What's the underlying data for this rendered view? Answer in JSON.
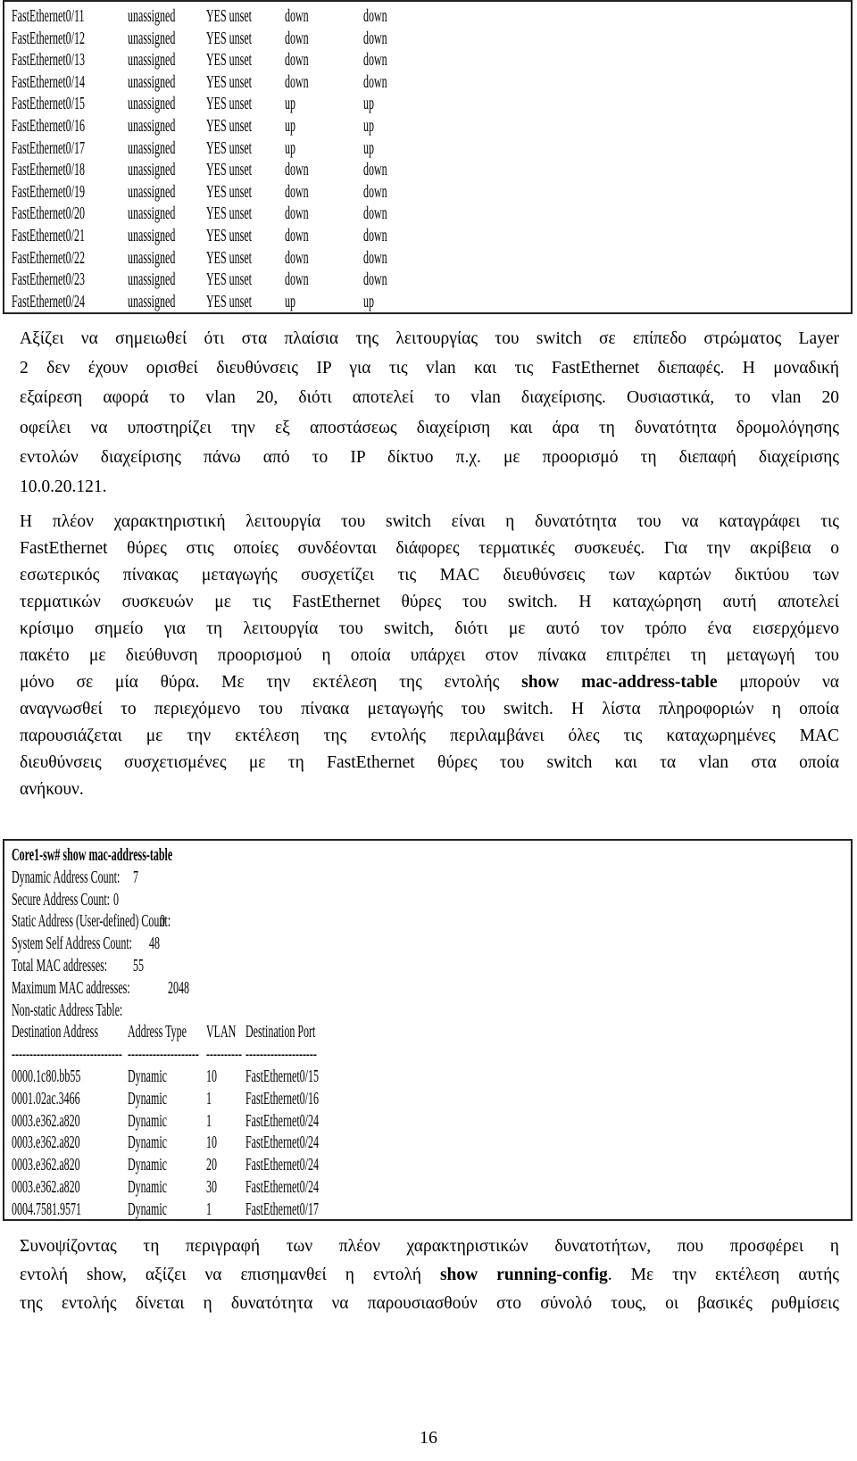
{
  "interface_table": [
    [
      "FastEthernet0/11",
      "unassigned",
      "YES unset",
      "down",
      "down"
    ],
    [
      "FastEthernet0/12",
      "unassigned",
      "YES unset",
      "down",
      "down"
    ],
    [
      "FastEthernet0/13",
      "unassigned",
      "YES unset",
      "down",
      "down"
    ],
    [
      "FastEthernet0/14",
      "unassigned",
      "YES unset",
      "down",
      "down"
    ],
    [
      "FastEthernet0/15",
      "unassigned",
      "YES unset",
      "up",
      "up"
    ],
    [
      "FastEthernet0/16",
      "unassigned",
      "YES unset",
      "up",
      "up"
    ],
    [
      "FastEthernet0/17",
      "unassigned",
      "YES unset",
      "up",
      "up"
    ],
    [
      "FastEthernet0/18",
      "unassigned",
      "YES unset",
      "down",
      "down"
    ],
    [
      "FastEthernet0/19",
      "unassigned",
      "YES unset",
      "down",
      "down"
    ],
    [
      "FastEthernet0/20",
      "unassigned",
      "YES unset",
      "down",
      "down"
    ],
    [
      "FastEthernet0/21",
      "unassigned",
      "YES unset",
      "down",
      "down"
    ],
    [
      "FastEthernet0/22",
      "unassigned",
      "YES unset",
      "down",
      "down"
    ],
    [
      "FastEthernet0/23",
      "unassigned",
      "YES unset",
      "down",
      "down"
    ],
    [
      "FastEthernet0/24",
      "unassigned",
      "YES unset",
      "up",
      "up"
    ]
  ],
  "paragraph1": [
    {
      "a": "Αξίζει να σημειωθεί ότι στα πλαίσια της λειτουργίας του switch σε επίπεδο στρώματος Layer"
    },
    {
      "a": "2 δεν έχουν ορισθεί διευθύνσεις IP για τις vlan και τις FastEthernet διεπαφές. Η μοναδική"
    },
    {
      "a": "εξαίρεση αφορά το vlan 20, διότι αποτελεί το vlan διαχείρισης. Ουσιαστικά, το vlan 20"
    },
    {
      "a": "οφείλει να υποστηρίζει την εξ αποστάσεως διαχείριση και άρα τη δυνατότητα δρομολόγησης"
    },
    {
      "a": "εντολών διαχείρισης πάνω από το IP δίκτυο π.χ. με προορισμό τη διεπαφή διαχείρισης"
    },
    {
      "a": "10.0.20.121."
    }
  ],
  "paragraph2": [
    {
      "a": "Η πλέον χαρακτηριστική λειτουργία του switch είναι η δυνατότητα του να καταγράφει τις"
    },
    {
      "a": "FastEthernet θύρες στις οποίες συνδέονται διάφορες τερματικές συσκευές. Για την ακρίβεια ο"
    },
    {
      "a": "εσωτερικός πίνακας μεταγωγής συσχετίζει τις MAC διευθύνσεις των καρτών δικτύου των"
    },
    {
      "a": "τερματικών συσκευών με τις FastEthernet θύρες του switch. Η καταχώρηση αυτή αποτελεί"
    },
    {
      "a": "κρίσιμο σημείο για τη λειτουργία του switch, διότι με αυτό τον τρόπο ένα εισερχόμενο"
    },
    {
      "a": "πακέτο με διεύθυνση προορισμού η οποία υπάρχει στον πίνακα επιτρέπει τη μεταγωγή του"
    },
    {
      "a": "μόνο σε μία θύρα. Με την εκτέλεση της εντολής ",
      "b": "show mac-address-table",
      "c": " μπορούν να"
    },
    {
      "a": "αναγνωσθεί το περιεχόμενο του πίνακα μεταγωγής του switch. Η λίστα πληροφοριών η οποία"
    },
    {
      "a": "παρουσιάζεται με την εκτέλεση της εντολής περιλαμβάνει όλες τις καταχωρημένες MAC"
    },
    {
      "a": "διευθύνσεις συσχετισμένες με τη FastEthernet θύρες του switch και τα vlan στα οποία"
    },
    {
      "a": "ανήκουν."
    }
  ],
  "mac_box": {
    "command": "Core1-sw# show mac-address-table",
    "counts": [
      {
        "label": "Dynamic Address Count:",
        "value": "7"
      },
      {
        "label": "Secure Address Count:",
        "value": "0"
      },
      {
        "label": "Static Address (User-defined) Count:",
        "value": "0"
      },
      {
        "label": "System Self Address Count:",
        "value": "48"
      },
      {
        "label": "Total MAC addresses:",
        "value": "55"
      },
      {
        "label": "Maximum MAC addresses:",
        "value": "2048"
      }
    ],
    "table_title": "Non-static Address Table:",
    "headers": [
      "Destination Address",
      "Address Type",
      "VLAN",
      "Destination Port"
    ],
    "dashes": [
      "-------------------------------",
      "--------------------",
      "----------",
      "--------------------"
    ],
    "rows": [
      [
        "0000.1c80.bb55",
        "Dynamic",
        "10",
        "FastEthernet0/15"
      ],
      [
        "0001.02ac.3466",
        "Dynamic",
        "1",
        "FastEthernet0/16"
      ],
      [
        "0003.e362.a820",
        "Dynamic",
        "1",
        "FastEthernet0/24"
      ],
      [
        "0003.e362.a820",
        "Dynamic",
        "10",
        "FastEthernet0/24"
      ],
      [
        "0003.e362.a820",
        "Dynamic",
        "20",
        "FastEthernet0/24"
      ],
      [
        "0003.e362.a820",
        "Dynamic",
        "30",
        "FastEthernet0/24"
      ],
      [
        "0004.7581.9571",
        "Dynamic",
        "1",
        "FastEthernet0/17"
      ]
    ]
  },
  "paragraph3": [
    {
      "a": "Συνοψίζοντας τη περιγραφή των πλέον χαρακτηριστικών δυνατοτήτων, που προσφέρει η"
    },
    {
      "a": "εντολή show, αξίζει να επισημανθεί η εντολή ",
      "b": "show running-config",
      "c": ". Με την εκτέλεση αυτής"
    },
    {
      "a": "της εντολής δίνεται η δυνατότητα να παρουσιασθούν στο σύνολό τους, οι βασικές ρυθμίσεις"
    }
  ],
  "page_number": "16"
}
